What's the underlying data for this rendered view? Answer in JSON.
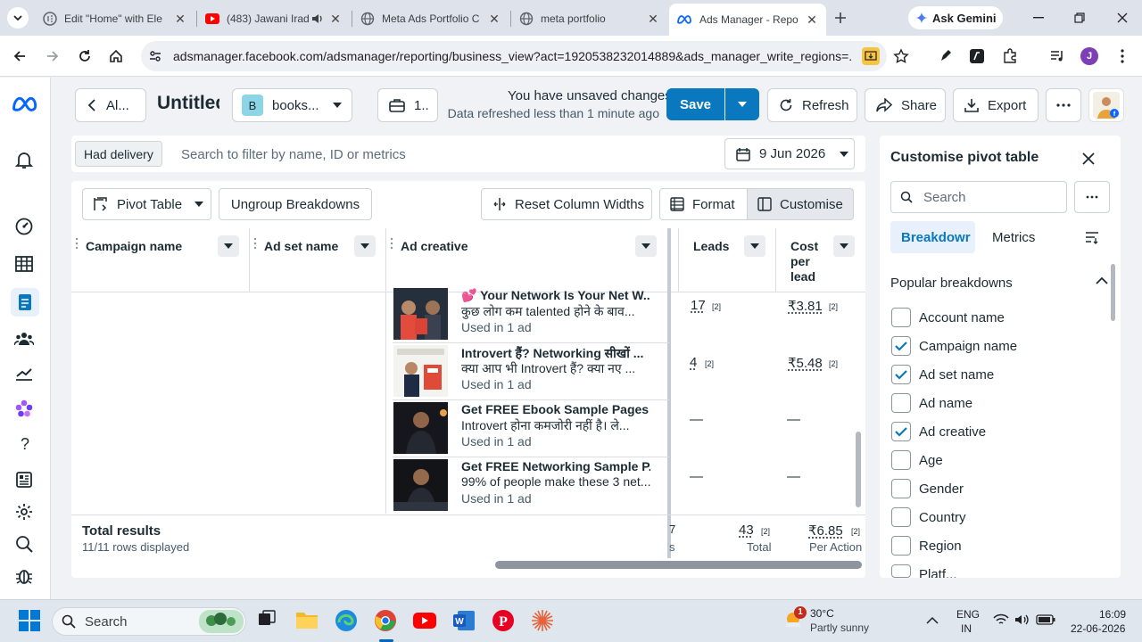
{
  "browser": {
    "tabs": [
      {
        "title": "Edit \"Home\" with Ele",
        "icon": "elementor-icon"
      },
      {
        "title": "(483) Jawani Irad",
        "icon": "youtube-icon"
      },
      {
        "title": "Meta Ads Portfolio C",
        "icon": "globe-icon"
      },
      {
        "title": "meta portfolio",
        "icon": "globe-icon"
      },
      {
        "title": "Ads Manager - Repo",
        "icon": "meta-icon"
      }
    ],
    "ask_gemini": "Ask Gemini",
    "url": "adsmanager.facebook.com/adsmanager/reporting/business_view?act=1920538232014889&ads_manager_write_regions=...",
    "profile_initial": "J"
  },
  "header": {
    "back_label": "Al...",
    "report_title": "Untitled",
    "account_initial": "B",
    "account_label": "books...",
    "date_chip": "1..",
    "unsaved": "You have unsaved changes",
    "refreshed": "Data refreshed less than 1 minute ago",
    "save": "Save",
    "refresh": "Refresh",
    "share": "Share",
    "export": "Export"
  },
  "filter": {
    "chip": "Had delivery",
    "placeholder": "Search to filter by name, ID or metrics",
    "date": "9 Jun 2026"
  },
  "toolbar": {
    "pivot": "Pivot Table",
    "ungroup": "Ungroup Breakdowns",
    "reset": "Reset Column Widths",
    "format": "Format",
    "customise": "Customise"
  },
  "columns": {
    "campaign": "Campaign name",
    "adset": "Ad set name",
    "creative": "Ad creative",
    "leads": "Leads",
    "cpl1": "Cost",
    "cpl2": "per",
    "cpl3": "lead"
  },
  "rows": [
    {
      "title": "💕 Your Network Is Your Net W...",
      "body": "कुछ लोग कम talented होने के बाव...",
      "used": "Used in 1 ad",
      "leads": "17",
      "leads_sup": "[2]",
      "cpl": "₹3.81",
      "cpl_sup": "[2]"
    },
    {
      "title": "Introvert हैं? Networking सीखों ...",
      "body": "क्या आप भी Introvert हैं? क्या नए ...",
      "used": "Used in 1 ad",
      "leads": "4",
      "leads_sup": "[2]",
      "cpl": "₹5.48",
      "cpl_sup": "[2]"
    },
    {
      "title": "Get FREE Ebook Sample Pages",
      "body": "Introvert होना कमजोरी नहीं है। ले...",
      "used": "Used in 1 ad",
      "leads": "—",
      "cpl": "—"
    },
    {
      "title": "Get FREE Networking Sample P...",
      "body": "99% of people make these 3 net...",
      "used": "Used in 1 ad",
      "leads": "—",
      "cpl": "—"
    }
  ],
  "totals": {
    "label": "Total results",
    "rows": "11/11 rows displayed",
    "partial1": "7",
    "partial2": "s",
    "leads": "43",
    "leads_sup": "[2]",
    "leads_cap": "Total",
    "cpl": "₹6.85",
    "cpl_sup": "[2]",
    "cpl_cap": "Per Action"
  },
  "customise_panel": {
    "title": "Customise pivot table",
    "search_placeholder": "Search",
    "tab_breakdown": "Breakdowr",
    "tab_metrics": "Metrics",
    "section": "Popular breakdowns",
    "items": [
      {
        "label": "Account name",
        "checked": false
      },
      {
        "label": "Campaign name",
        "checked": true
      },
      {
        "label": "Ad set name",
        "checked": true
      },
      {
        "label": "Ad name",
        "checked": false
      },
      {
        "label": "Ad creative",
        "checked": true
      },
      {
        "label": "Age",
        "checked": false
      },
      {
        "label": "Gender",
        "checked": false
      },
      {
        "label": "Country",
        "checked": false
      },
      {
        "label": "Region",
        "checked": false
      },
      {
        "label": "Platf...",
        "checked": false
      }
    ]
  },
  "taskbar": {
    "search": "Search",
    "weather_temp": "30°C",
    "weather_desc": "Partly sunny",
    "weather_badge": "1",
    "lang1": "ENG",
    "lang2": "IN",
    "time": "16:09",
    "date": "22-06-2026"
  },
  "colors": {
    "accent": "#0a78be",
    "primary": "#0064e0",
    "meta_blue": "#0866ff",
    "check": "#0a78be"
  }
}
